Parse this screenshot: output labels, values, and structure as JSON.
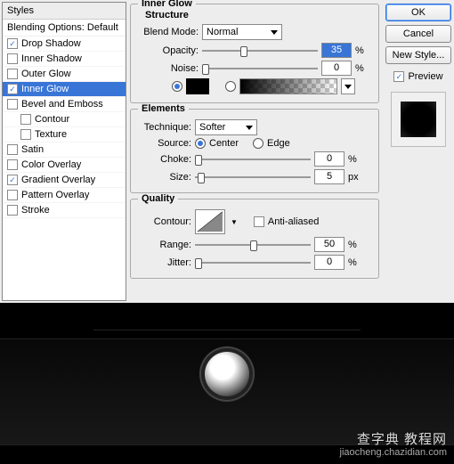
{
  "sidebar": {
    "header": "Styles",
    "blending_default": "Blending Options: Default",
    "items": [
      {
        "label": "Drop Shadow",
        "checked": true
      },
      {
        "label": "Inner Shadow",
        "checked": false
      },
      {
        "label": "Outer Glow",
        "checked": false
      },
      {
        "label": "Inner Glow",
        "checked": true,
        "active": true
      },
      {
        "label": "Bevel and Emboss",
        "checked": false
      },
      {
        "label": "Contour",
        "checked": false,
        "indent": true
      },
      {
        "label": "Texture",
        "checked": false,
        "indent": true
      },
      {
        "label": "Satin",
        "checked": false
      },
      {
        "label": "Color Overlay",
        "checked": false
      },
      {
        "label": "Gradient Overlay",
        "checked": true
      },
      {
        "label": "Pattern Overlay",
        "checked": false
      },
      {
        "label": "Stroke",
        "checked": false
      }
    ]
  },
  "panel": {
    "title": "Inner Glow",
    "structure": {
      "heading": "Structure",
      "blend_mode_label": "Blend Mode:",
      "blend_mode_value": "Normal",
      "opacity_label": "Opacity:",
      "opacity_value": "35",
      "opacity_unit": "%",
      "noise_label": "Noise:",
      "noise_value": "0",
      "noise_unit": "%",
      "color": "#000000"
    },
    "elements": {
      "heading": "Elements",
      "technique_label": "Technique:",
      "technique_value": "Softer",
      "source_label": "Source:",
      "source_center": "Center",
      "source_edge": "Edge",
      "choke_label": "Choke:",
      "choke_value": "0",
      "choke_unit": "%",
      "size_label": "Size:",
      "size_value": "5",
      "size_unit": "px"
    },
    "quality": {
      "heading": "Quality",
      "contour_label": "Contour:",
      "anti_aliased": "Anti-aliased",
      "range_label": "Range:",
      "range_value": "50",
      "range_unit": "%",
      "jitter_label": "Jitter:",
      "jitter_value": "0",
      "jitter_unit": "%"
    }
  },
  "buttons": {
    "ok": "OK",
    "cancel": "Cancel",
    "new_style": "New Style...",
    "preview": "Preview"
  },
  "watermark": {
    "line1": "查字典 教程网",
    "line2": "jiaocheng.chazidian.com"
  }
}
